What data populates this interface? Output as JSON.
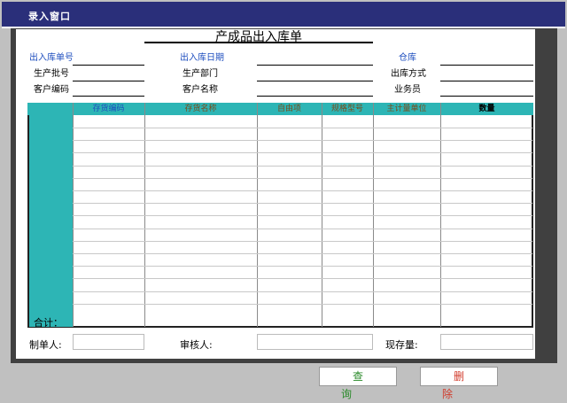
{
  "window": {
    "title": "录入窗口"
  },
  "form": {
    "title": "产成品出入库单",
    "labels": {
      "order_no": "出入库单号",
      "date": "出入库日期",
      "warehouse": "仓库",
      "batch_no": "生产批号",
      "dept": "生产部门",
      "out_method": "出库方式",
      "customer_code": "客户编码",
      "customer_name": "客户名称",
      "salesman": "业务员"
    }
  },
  "table": {
    "headers": [
      "存货编码",
      "存货名称",
      "自由项",
      "规格型号",
      "主计量单位",
      "数量"
    ],
    "total_label": "合计："
  },
  "footer": {
    "maker_label": "制单人:",
    "reviewer_label": "审核人:",
    "stock_label": "现存量:"
  },
  "buttons": {
    "query": "查询",
    "delete": "删除"
  },
  "colors": {
    "titlebar": "#2a2f7a",
    "grid_header": "#2db5b5",
    "blue_label": "#1f4fbf",
    "query_text": "#2a8a2a",
    "delete_text": "#d13a2a"
  }
}
